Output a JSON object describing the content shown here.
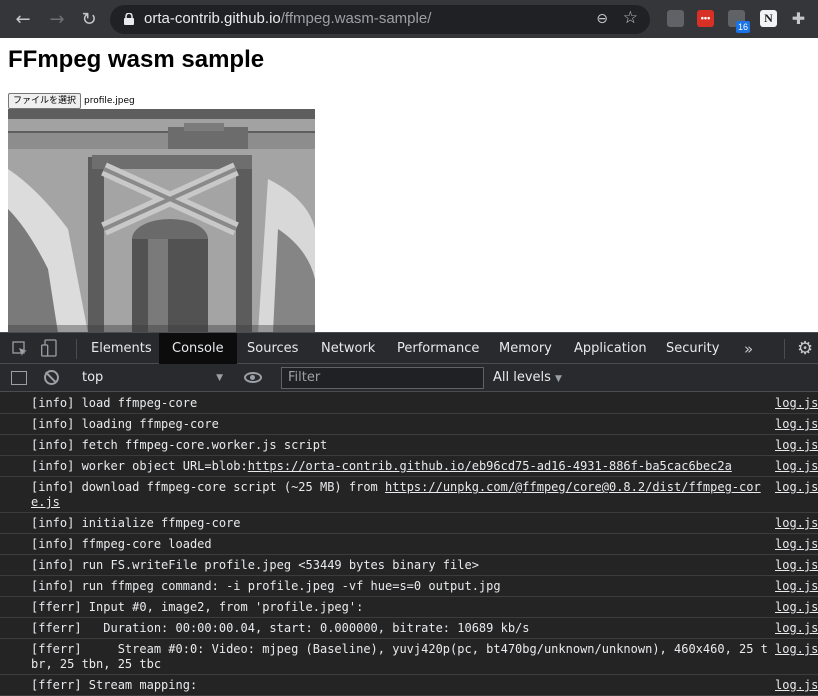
{
  "browser": {
    "url_host": "orta-contrib.github.io",
    "url_path": "/ffmpeg.wasm-sample/",
    "extension_badge": "16",
    "extension_red_label": "•••",
    "extension_notion_label": "N",
    "icons": [
      "back-icon",
      "forward-icon",
      "reload-icon",
      "lock-icon",
      "zoom-icon",
      "star-icon",
      "puzzle-icon"
    ]
  },
  "page": {
    "title": "FFmpeg wasm sample",
    "file_button_label": "ファイルを選択",
    "file_name": "profile.jpeg"
  },
  "devtools": {
    "tabs": [
      "Elements",
      "Console",
      "Sources",
      "Network",
      "Performance",
      "Memory",
      "Application",
      "Security"
    ],
    "active_tab": "Console",
    "more_tabs": "»",
    "context": "top",
    "filter_placeholder": "Filter",
    "levels": "All levels",
    "logs": [
      {
        "msg": "[info] load ffmpeg-core",
        "src": "log.js"
      },
      {
        "msg": "[info] loading ffmpeg-core",
        "src": "log.js"
      },
      {
        "msg": "[info] fetch ffmpeg-core.worker.js script",
        "src": "log.js"
      },
      {
        "msg_prefix": "[info] worker object URL=blob:",
        "link": "https://orta-contrib.github.io/eb96cd75-ad16-4931-886f-ba5cac6bec2a",
        "src": "log.js"
      },
      {
        "msg_prefix": "[info] download ffmpeg-core script (~25 MB) from ",
        "link": "https://unpkg.com/@ffmpeg/core@0.8.2/dist/ffmpeg-core.js",
        "src": "log.js"
      },
      {
        "msg": "[info] initialize ffmpeg-core",
        "src": "log.js"
      },
      {
        "msg": "[info] ffmpeg-core loaded",
        "src": "log.js"
      },
      {
        "msg": "[info] run FS.writeFile profile.jpeg <53449 bytes binary file>",
        "src": "log.js"
      },
      {
        "msg": "[info] run ffmpeg command: -i profile.jpeg -vf hue=s=0 output.jpg",
        "src": "log.js"
      },
      {
        "msg": "[fferr] Input #0, image2, from 'profile.jpeg':",
        "src": "log.js"
      },
      {
        "msg": "[fferr]   Duration: 00:00:00.04, start: 0.000000, bitrate: 10689 kb/s",
        "src": "log.js"
      },
      {
        "msg": "[fferr]     Stream #0:0: Video: mjpeg (Baseline), yuvj420p(pc, bt470bg/unknown/unknown), 460x460, 25 tbr, 25 tbn, 25 tbc",
        "src": "log.js"
      },
      {
        "msg": "[fferr] Stream mapping:",
        "src": "log.js"
      }
    ]
  }
}
